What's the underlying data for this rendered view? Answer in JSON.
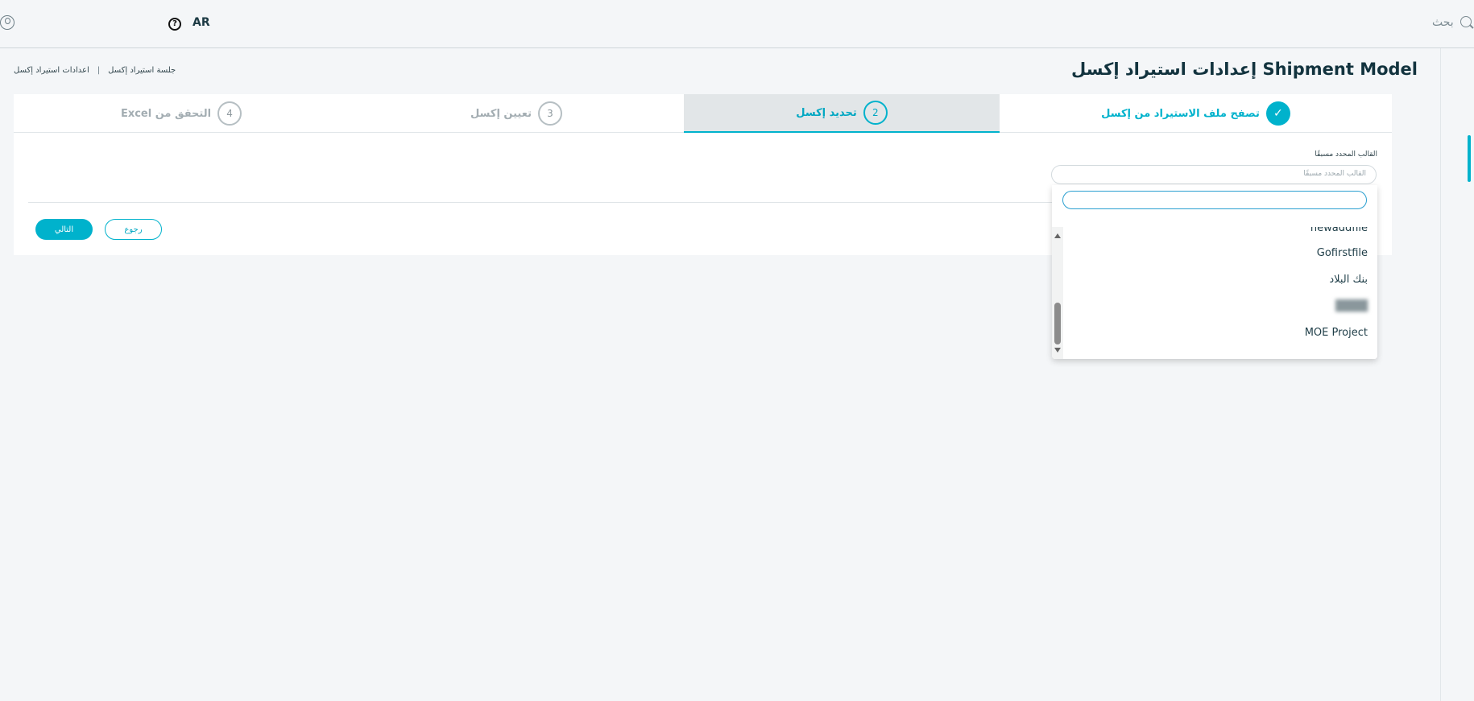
{
  "header": {
    "lang": "AR",
    "search_label": "بحث",
    "help_symbol": "?"
  },
  "page": {
    "title": "Shipment Model إعدادات استيراد إكسل",
    "breadcrumb": [
      "جلسة استيراد إكسل",
      "اعدادات استيراد إكسل"
    ]
  },
  "steps": [
    {
      "number": "✓",
      "label": "تصفح ملف الاستيراد من إكسل",
      "state": "done"
    },
    {
      "number": "2",
      "label": "تحديد إكسل",
      "state": "active"
    },
    {
      "number": "3",
      "label": "تعيين إكسل",
      "state": "pending"
    },
    {
      "number": "4",
      "label": "التحقق من Excel",
      "state": "pending"
    }
  ],
  "form": {
    "field_label": "القالب المحدد مسبقًا",
    "select_placeholder": "القالب المحدد مسبقًا"
  },
  "dropdown": {
    "search_value": "",
    "options": [
      "newaddfile",
      "Gofirstfile",
      "بنك البلاد",
      "████",
      "MOE Project"
    ]
  },
  "buttons": {
    "next": "التالي",
    "back": "رجوع"
  },
  "colors": {
    "accent": "#00b2cc",
    "background": "#f4f6f8"
  }
}
